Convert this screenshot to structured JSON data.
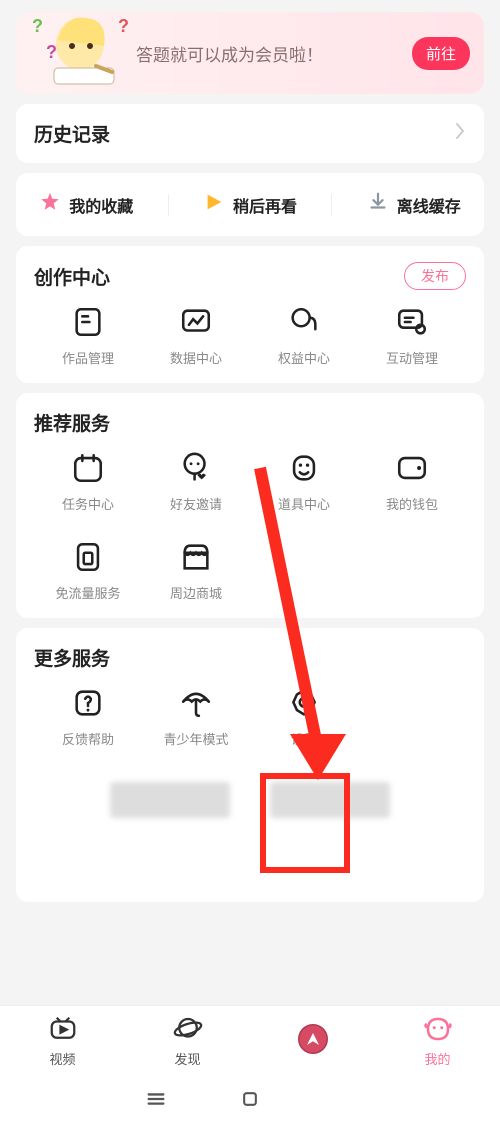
{
  "banner": {
    "text": "答题就可以成为会员啦！",
    "button": "前往"
  },
  "history": {
    "title": "历史记录"
  },
  "quick": {
    "fav": "我的收藏",
    "later": "稍后再看",
    "offline": "离线缓存"
  },
  "creator": {
    "title": "创作中心",
    "publish": "发布",
    "items": [
      {
        "label": "作品管理"
      },
      {
        "label": "数据中心"
      },
      {
        "label": "权益中心"
      },
      {
        "label": "互动管理"
      }
    ]
  },
  "recommend": {
    "title": "推荐服务",
    "items": [
      {
        "label": "任务中心"
      },
      {
        "label": "好友邀请"
      },
      {
        "label": "道具中心"
      },
      {
        "label": "我的钱包"
      },
      {
        "label": "免流量服务"
      },
      {
        "label": "周边商城"
      }
    ]
  },
  "more": {
    "title": "更多服务",
    "items": [
      {
        "label": "反馈帮助"
      },
      {
        "label": "青少年模式"
      },
      {
        "label": "设置"
      }
    ]
  },
  "nav": {
    "video": "视频",
    "discover": "发现",
    "mine": "我的"
  }
}
